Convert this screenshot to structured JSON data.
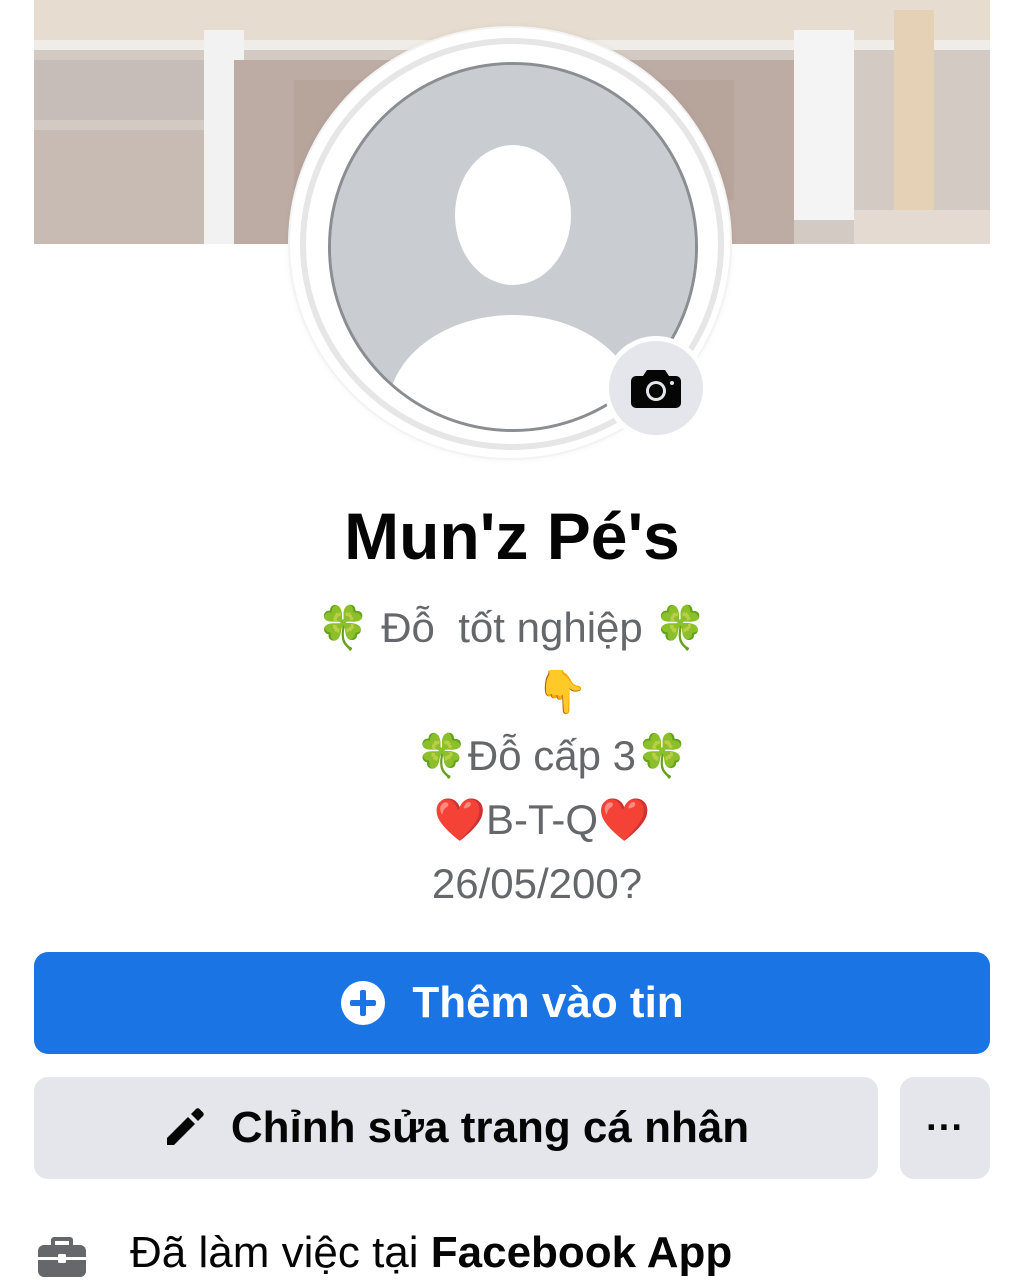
{
  "profile": {
    "name": "Mun'z Pé's",
    "bio_lines": [
      "🍀 Đỗ  tốt nghiệp 🍀",
      "👇",
      "🍀Đỗ cấp 3🍀",
      "❤️B-T-Q❤️",
      "26/05/200?"
    ]
  },
  "actions": {
    "add_story_label": "Thêm vào tin",
    "edit_profile_label": "Chỉnh sửa trang cá nhân",
    "more_label": "···"
  },
  "work": {
    "prefix": "Đã làm việc tại ",
    "place": "Facebook App"
  },
  "icons": {
    "camera": "camera-icon",
    "add": "plus-circle-icon",
    "edit": "pencil-icon",
    "work": "briefcase-icon"
  },
  "colors": {
    "primary": "#1b74e4",
    "secondary_bg": "#e4e6eb",
    "text": "#050505",
    "muted_text": "#65676b"
  }
}
